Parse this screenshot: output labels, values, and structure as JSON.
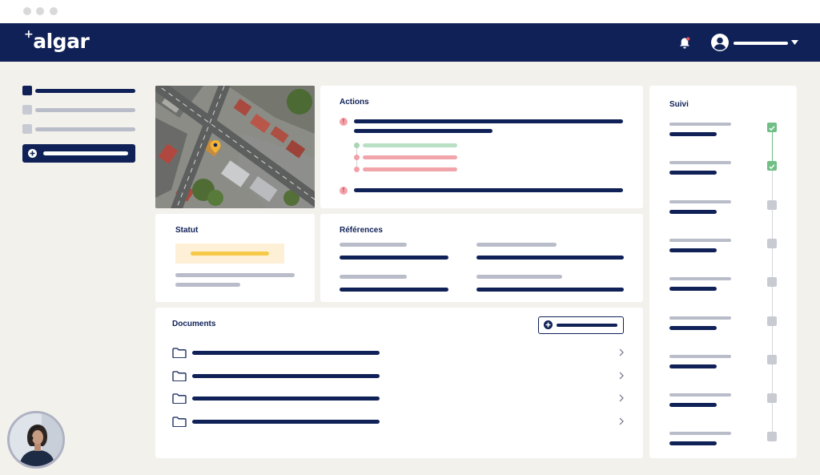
{
  "window": {
    "traffic_lights": [
      "close-dot",
      "minimize-dot",
      "maximize-dot"
    ]
  },
  "topbar": {
    "logo": "algar",
    "bell_icon": "bell-icon",
    "user_icon": "user-circle-icon",
    "caret_icon": "chevron-down-icon"
  },
  "sections": {
    "actions": "Actions",
    "statut": "Statut",
    "references": "Références",
    "documents": "Documents",
    "suivi": "Suivi"
  },
  "actions": {
    "badge_glyph": "!"
  },
  "suivi": {
    "steps_completed": 2,
    "steps_total": 9
  },
  "documents": {
    "folder_icon": "folder-icon",
    "row_icon": "chevron-right-icon",
    "count": 4
  },
  "colors": {
    "brand": "#0f2157",
    "background": "#f3f1ec",
    "success": "#6fbf85",
    "danger": "#f4a3aa",
    "warning": "#f7c948"
  }
}
